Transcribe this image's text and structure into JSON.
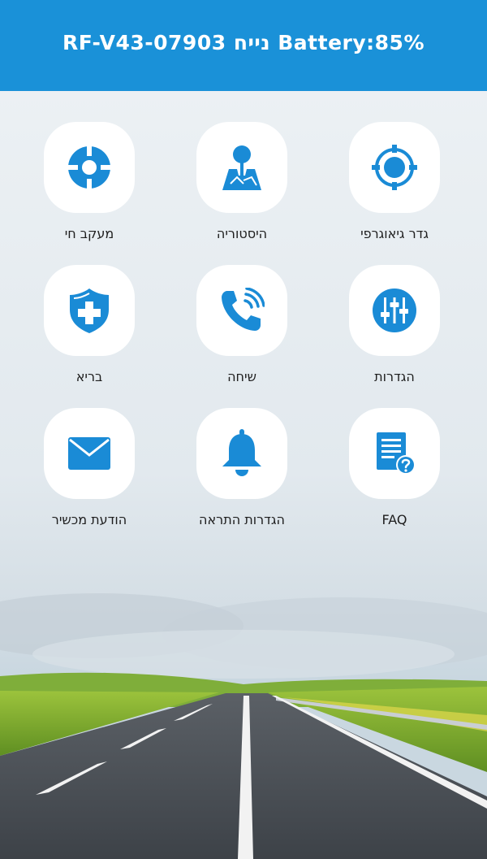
{
  "header": {
    "title": "RF-V43-07903 נייח Battery:85%"
  },
  "menu": [
    {
      "label": "מעקב חי",
      "icon": "crosshair-icon"
    },
    {
      "label": "היסטוריה",
      "icon": "map-pin-icon"
    },
    {
      "label": "גדר גיאוגרפי",
      "icon": "geofence-target-icon"
    },
    {
      "label": "בריא",
      "icon": "health-shield-icon"
    },
    {
      "label": "שיחה",
      "icon": "phone-call-icon"
    },
    {
      "label": "הגדרות",
      "icon": "sliders-icon"
    },
    {
      "label": "הודעת מכשיר",
      "icon": "envelope-icon"
    },
    {
      "label": "הגדרות התראה",
      "icon": "bell-icon"
    },
    {
      "label": "FAQ",
      "icon": "faq-document-icon"
    }
  ],
  "colors": {
    "accent": "#1a91d8",
    "icon": "#1a8bd6",
    "tile": "#ffffff"
  }
}
